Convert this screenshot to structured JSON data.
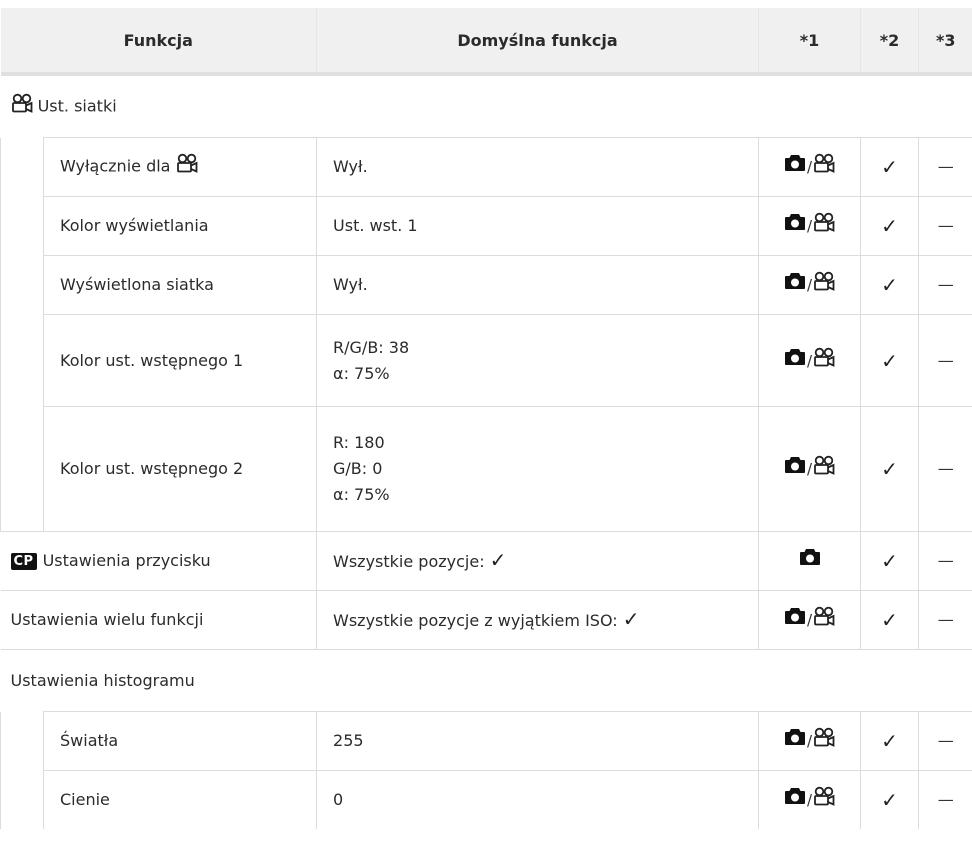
{
  "header": {
    "col_function": "Funkcja",
    "col_default": "Domyślna funkcja",
    "col_1": "*1",
    "col_2": "*2",
    "col_3": "*3"
  },
  "sections": {
    "grid": {
      "label": "Ust. siatki",
      "icon": "movie-camera-icon"
    },
    "histogram": {
      "label": "Ustawienia histogramu"
    }
  },
  "rows": {
    "exclusive": {
      "function": "Wyłącznie dla",
      "function_icon": "movie-camera-icon",
      "default": "Wył.",
      "mode": "photo-movie"
    },
    "display_color": {
      "function": "Kolor wyświetlania",
      "default": "Ust. wst. 1",
      "mode": "photo-movie"
    },
    "displayed_grid": {
      "function": "Wyświetlona siatka",
      "default": "Wył.",
      "mode": "photo-movie"
    },
    "preset_color_1": {
      "function": "Kolor ust. wstępnego 1",
      "default_lines": [
        "R/G/B: 38",
        "α: 75%"
      ],
      "mode": "photo-movie"
    },
    "preset_color_2": {
      "function": "Kolor ust. wstępnego 2",
      "default_lines": [
        "R: 180",
        "G/B: 0",
        "α: 75%"
      ],
      "mode": "photo-movie"
    },
    "button_settings": {
      "badge": "CP",
      "function": "Ustawienia przycisku",
      "default": "Wszystkie pozycje:",
      "mode": "photo"
    },
    "multi_function": {
      "function": "Ustawienia wielu funkcji",
      "default": "Wszystkie pozycje z wyjątkiem ISO:",
      "mode": "photo-movie"
    },
    "highlights": {
      "function": "Światła",
      "default": "255",
      "mode": "photo-movie"
    },
    "shadows": {
      "function": "Cienie",
      "default": "0",
      "mode": "photo-movie"
    }
  },
  "symbols": {
    "check": "✓",
    "dash": "—",
    "slash": "/"
  }
}
